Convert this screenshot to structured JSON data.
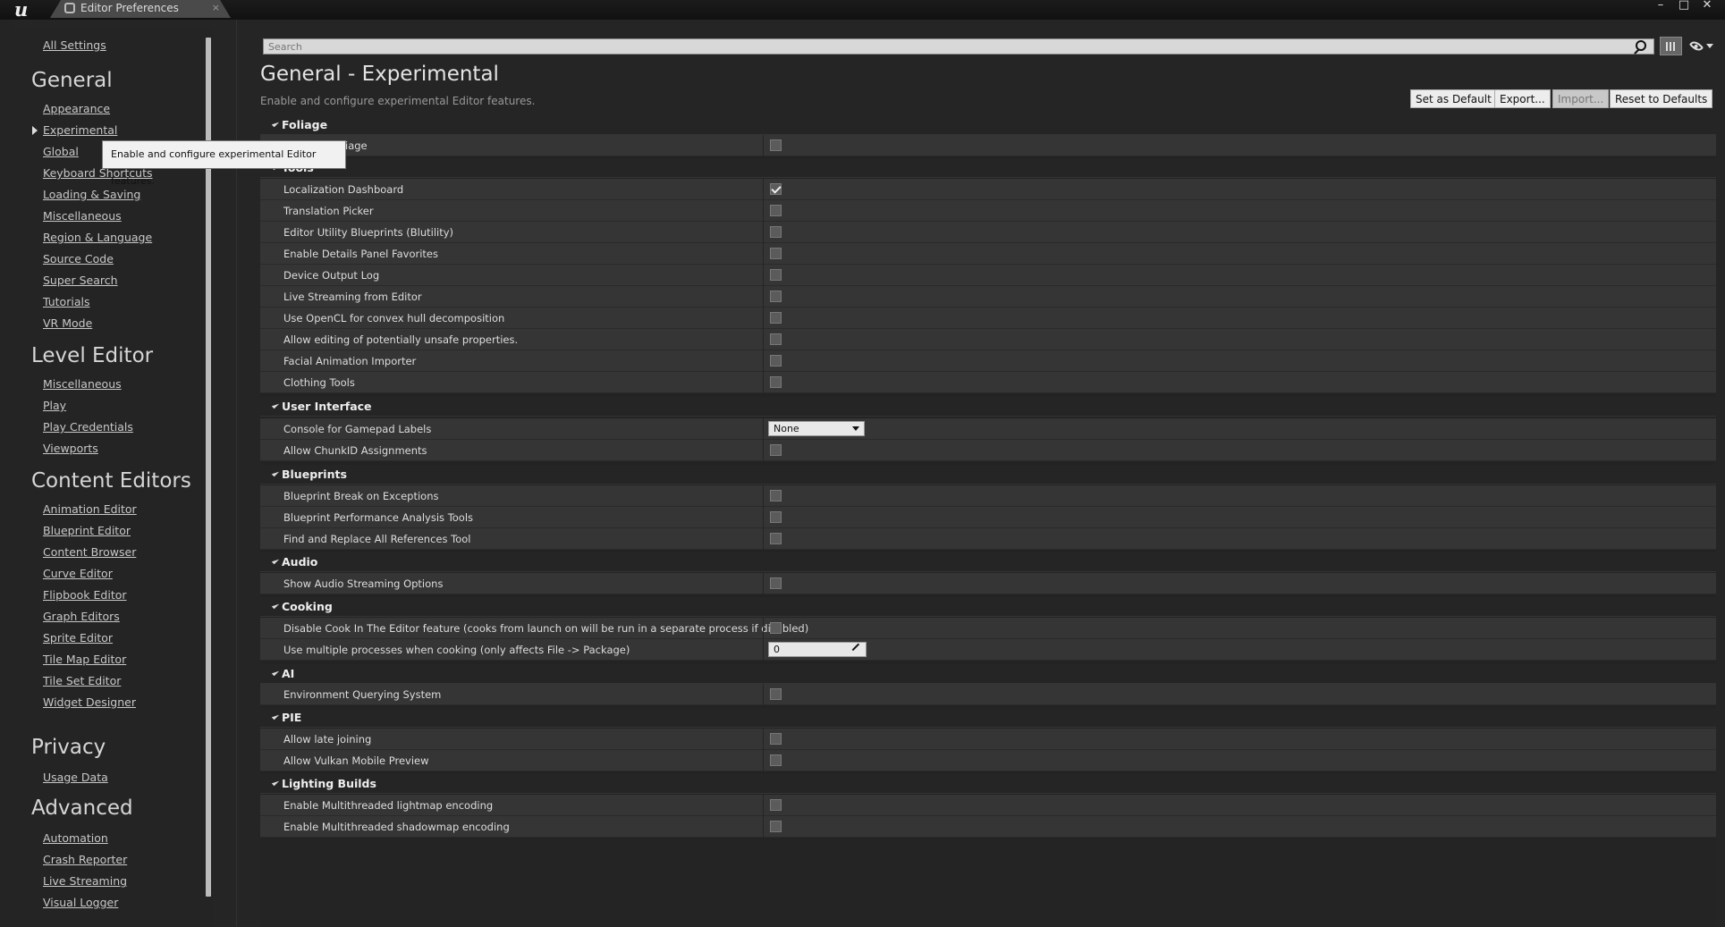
{
  "window": {
    "logo_text": "u",
    "tab_title": "Editor Preferences",
    "tab_close": "×",
    "minimize": "–",
    "maximize": "□",
    "close": "✕"
  },
  "sidebar": {
    "all_settings": "All Settings",
    "sections": [
      {
        "title": "General",
        "items": [
          "Appearance",
          "Experimental",
          "Global",
          "Keyboard Shortcuts",
          "Loading & Saving",
          "Miscellaneous",
          "Region & Language",
          "Source Code",
          "Super Search",
          "Tutorials",
          "VR Mode"
        ]
      },
      {
        "title": "Level Editor",
        "items": [
          "Miscellaneous",
          "Play",
          "Play Credentials",
          "Viewports"
        ]
      },
      {
        "title": "Content Editors",
        "items": [
          "Animation Editor",
          "Blueprint Editor",
          "Content Browser",
          "Curve Editor",
          "Flipbook Editor",
          "Graph Editors",
          "Sprite Editor",
          "Tile Map Editor",
          "Tile Set Editor",
          "Widget Designer"
        ]
      },
      {
        "title": "Privacy",
        "items": [
          "Usage Data"
        ]
      },
      {
        "title": "Advanced",
        "items": [
          "Automation",
          "Crash Reporter",
          "Live Streaming",
          "Visual Logger"
        ]
      }
    ]
  },
  "tooltip": "Enable and configure experimental Editor features.",
  "search": {
    "placeholder": "Search"
  },
  "page": {
    "title": "General - Experimental",
    "description": "Enable and configure experimental Editor features."
  },
  "actions": {
    "set_default": "Set as Default",
    "export": "Export...",
    "import": "Import...",
    "reset": "Reset to Defaults"
  },
  "settings": {
    "foliage": {
      "title": "Foliage",
      "rows": [
        {
          "label": "iage"
        }
      ]
    },
    "tools": {
      "title": "Tools",
      "rows": [
        {
          "label": "Localization Dashboard",
          "checked": true
        },
        {
          "label": "Translation Picker",
          "checked": false
        },
        {
          "label": "Editor Utility Blueprints (Blutility)",
          "checked": false
        },
        {
          "label": "Enable Details Panel Favorites",
          "checked": false
        },
        {
          "label": "Device Output Log",
          "checked": false
        },
        {
          "label": "Live Streaming from Editor",
          "checked": false
        },
        {
          "label": "Use OpenCL for convex hull decomposition",
          "checked": false
        },
        {
          "label": "Allow editing of potentially unsafe properties.",
          "checked": false
        },
        {
          "label": "Facial Animation Importer",
          "checked": false
        },
        {
          "label": "Clothing Tools",
          "checked": false
        }
      ]
    },
    "user_interface": {
      "title": "User Interface",
      "rows": [
        {
          "label": "Console for Gamepad Labels",
          "value": "None"
        },
        {
          "label": "Allow ChunkID Assignments",
          "checked": false
        }
      ]
    },
    "blueprints": {
      "title": "Blueprints",
      "rows": [
        {
          "label": "Blueprint Break on Exceptions",
          "checked": false
        },
        {
          "label": "Blueprint Performance Analysis Tools",
          "checked": false
        },
        {
          "label": "Find and Replace All References Tool",
          "checked": false
        }
      ]
    },
    "audio": {
      "title": "Audio",
      "rows": [
        {
          "label": "Show Audio Streaming Options",
          "checked": false
        }
      ]
    },
    "cooking": {
      "title": "Cooking",
      "rows": [
        {
          "label": "Disable Cook In The Editor feature (cooks from launch on will be run in a separate process if disabled)",
          "checked": false
        },
        {
          "label": "Use multiple processes when cooking (only affects File -> Package)",
          "value": "0"
        }
      ]
    },
    "ai": {
      "title": "AI",
      "rows": [
        {
          "label": "Environment Querying System",
          "checked": false
        }
      ]
    },
    "pie": {
      "title": "PIE",
      "rows": [
        {
          "label": "Allow late joining",
          "checked": false
        },
        {
          "label": "Allow Vulkan Mobile Preview",
          "checked": false
        }
      ]
    },
    "lighting_builds": {
      "title": "Lighting Builds",
      "rows": [
        {
          "label": "Enable Multithreaded lightmap encoding",
          "checked": false
        },
        {
          "label": "Enable Multithreaded shadowmap encoding",
          "checked": false
        }
      ]
    }
  }
}
